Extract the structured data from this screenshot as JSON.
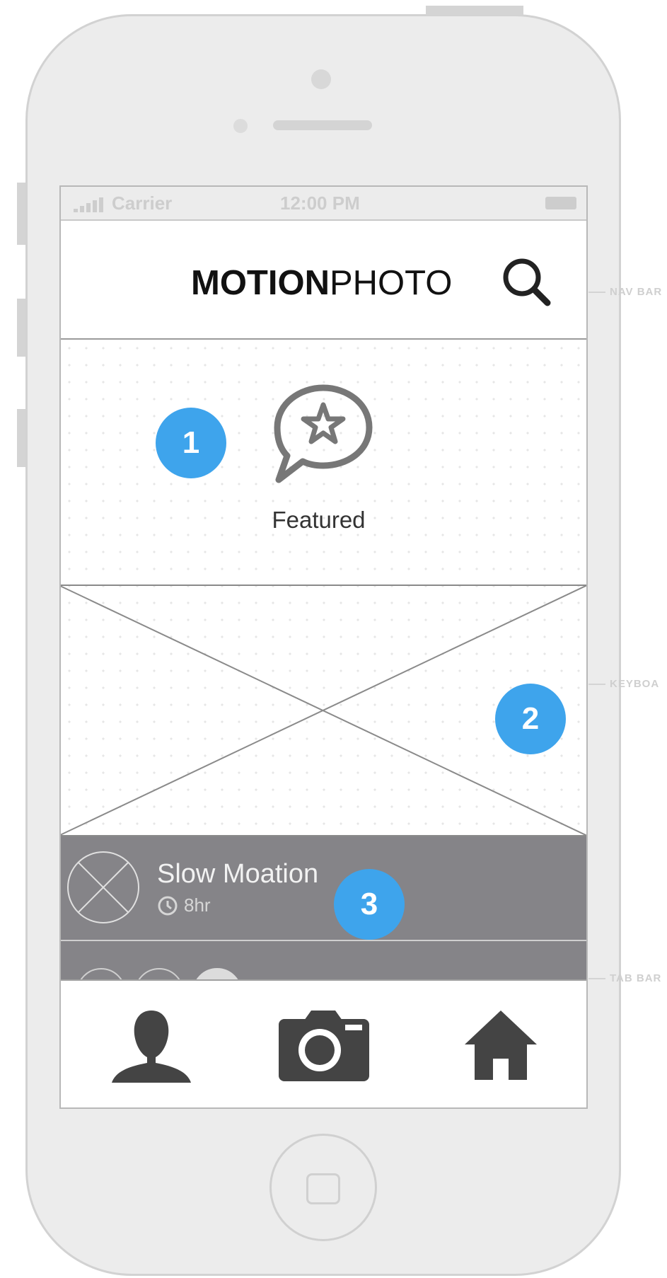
{
  "statusbar": {
    "carrier": "Carrier",
    "time": "12:00 PM"
  },
  "navbar": {
    "title_bold": "MOTION",
    "title_light": "PHOTO",
    "icon": "search-icon"
  },
  "featured": {
    "label": "Featured",
    "icon": "chat-star-icon"
  },
  "placeholder": {
    "icon": "image-placeholder"
  },
  "list_item": {
    "title": "Slow Moation",
    "duration": "8hr",
    "time_icon": "clock-icon",
    "thumb_icon": "image-placeholder-circle"
  },
  "tabbar": {
    "items": [
      {
        "icon": "user-icon"
      },
      {
        "icon": "camera-icon"
      },
      {
        "icon": "home-icon"
      }
    ]
  },
  "badges": [
    "1",
    "2",
    "3"
  ],
  "annotations": {
    "navbar": "NAV BAR",
    "keyboard": "KEYBOA",
    "tabbar": "TAB BAR"
  },
  "colors": {
    "badge": "#3ea4ec",
    "list_bg": "#858488",
    "phone_body": "#ececec"
  }
}
